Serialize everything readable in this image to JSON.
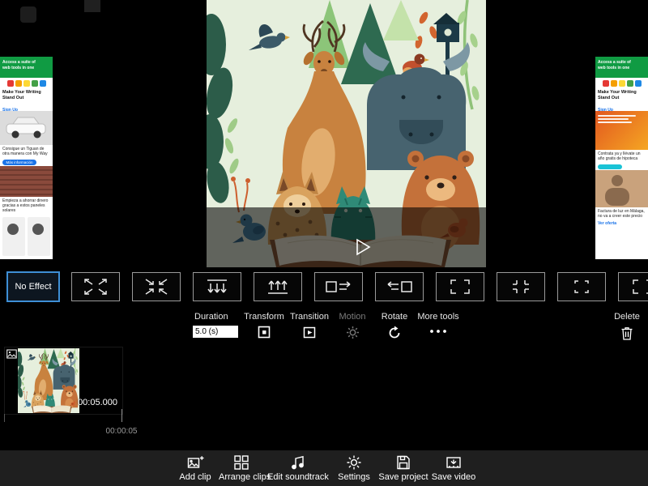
{
  "colors": {
    "accent_blue": "#3e8fd6",
    "ad_green": "#109b43",
    "toolbar_bg": "#1f1f1f"
  },
  "effects_bar": {
    "no_effect_label": "No Effect",
    "effects": [
      {
        "icon": "zoom-in-arrows"
      },
      {
        "icon": "zoom-out-arrows"
      },
      {
        "icon": "pan-down-arrows"
      },
      {
        "icon": "pan-up-arrows"
      },
      {
        "icon": "pan-right-box"
      },
      {
        "icon": "pan-left-box"
      },
      {
        "icon": "corners-out-brackets"
      },
      {
        "icon": "corners-in-brackets"
      },
      {
        "icon": "corner-brackets"
      },
      {
        "icon": "corner-brackets"
      }
    ]
  },
  "controls": {
    "duration_label": "Duration",
    "duration_value": "5.0 (s)",
    "transform_label": "Transform",
    "transition_label": "Transition",
    "motion_label": "Motion",
    "rotate_label": "Rotate",
    "more_tools_label": "More tools",
    "delete_label": "Delete"
  },
  "timeline": {
    "clip_duration_label": "00:05.000",
    "ruler_time_label": "00:00:05"
  },
  "toolbar": {
    "items": [
      {
        "label": "Add clip",
        "icon": "add-clip-icon"
      },
      {
        "label": "Arrange clips",
        "icon": "arrange-clips-icon"
      },
      {
        "label": "Edit soundtrack",
        "icon": "music-note-icon"
      },
      {
        "label": "Settings",
        "icon": "gear-icon"
      },
      {
        "label": "Save project",
        "icon": "floppy-icon"
      },
      {
        "label": "Save video",
        "icon": "export-video-icon"
      }
    ]
  },
  "ads": {
    "left": {
      "banner_line1": "Access a suite of",
      "banner_line2": "web tools in one",
      "writing_title": "Make Your Writing Stand Out",
      "writing_cta": "Sign Up",
      "car_text": "Consigue un Tiguan de otra manera con My Way",
      "car_cta": "Más información",
      "solar_text": "Empieza a ahorrar dinero gracias a estos paneles solares"
    },
    "right": {
      "banner_line1": "Access a suite of",
      "banner_line2": "web tools in one",
      "writing_title": "Make Your Writing Stand Out",
      "writing_cta": "Sign Up",
      "mortgage_text": "Contrata ya y llévate un año gratis de hipoteca",
      "bills_text": "Factura de luz en Málaga, no va a creer este precio",
      "bills_cta": "Ver oferta"
    }
  }
}
